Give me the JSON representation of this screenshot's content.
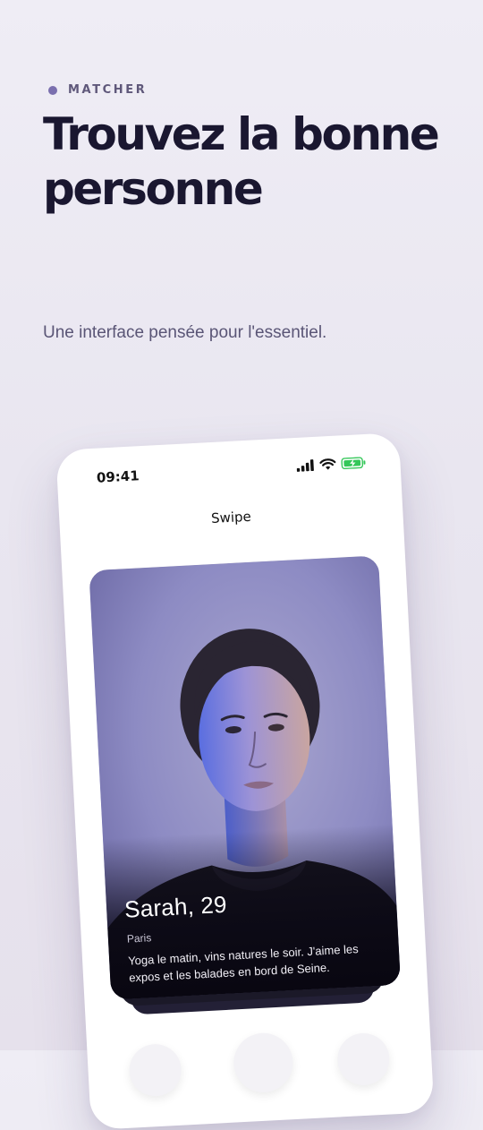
{
  "hero": {
    "eyebrow": "MATCHER",
    "title": "Trouvez la bonne personne",
    "subtitle": "Une interface pensée pour l'essentiel."
  },
  "phone": {
    "status_bar": {
      "time": "09:41",
      "icons": [
        "signal-icon",
        "wifi-icon",
        "battery-charging-icon"
      ]
    },
    "screen_title": "Swipe",
    "profile_card": {
      "name": "Sarah, 29",
      "city": "Paris",
      "bio": "Yoga le matin, vins natures le soir. J'aime les expos et les balades en bord de Seine."
    },
    "actions": [
      {
        "name": "dislike-button"
      },
      {
        "name": "superlike-button"
      },
      {
        "name": "like-button"
      }
    ]
  },
  "colors": {
    "accent": "#7a6fae",
    "heading": "#1a1730",
    "subtitle": "#5a5576",
    "battery": "#34c759"
  }
}
